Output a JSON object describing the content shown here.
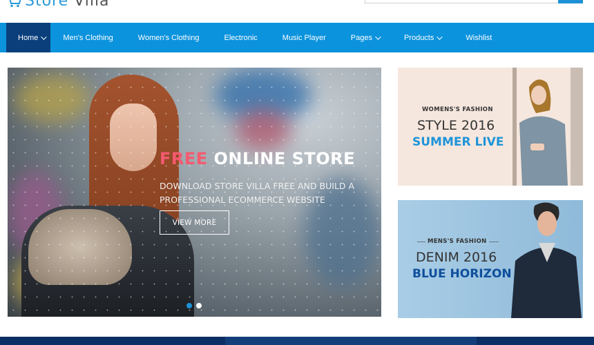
{
  "brand": {
    "logo_primary": "Store",
    "logo_secondary": "Villa",
    "logo_icon": "shopping-cart-icon",
    "accent": "#1e91d6"
  },
  "search": {
    "placeholder": ""
  },
  "nav": {
    "items": [
      {
        "label": "Home",
        "dropdown": true,
        "active": true
      },
      {
        "label": "Men's Clothing",
        "dropdown": false
      },
      {
        "label": "Women's Clothing",
        "dropdown": false
      },
      {
        "label": "Electronic",
        "dropdown": false
      },
      {
        "label": "Music Player",
        "dropdown": false
      },
      {
        "label": "Pages",
        "dropdown": true
      },
      {
        "label": "Products",
        "dropdown": true
      },
      {
        "label": "Wishlist",
        "dropdown": false
      }
    ],
    "bg_color": "#0b93dd",
    "active_color": "#0a3f7c"
  },
  "hero": {
    "title_accent": "FREE",
    "title_rest": "ONLINE STORE",
    "subtitle": "DOWNLOAD STORE VILLA FREE AND BUILD A PROFESSIONAL ECOMMERCE WEBSITE",
    "button_label": "VIEW MORE",
    "slides": 2,
    "active_slide": 1,
    "accent_color": "#f45a70"
  },
  "banners": [
    {
      "tag": "WOMENS'S FASHION",
      "headline": "STYLE 2016",
      "highlight": "SUMMER LIVE"
    },
    {
      "tag": "MENS'S FASHION",
      "headline": "DENIM 2016",
      "highlight": "BLUE HORIZON"
    }
  ]
}
